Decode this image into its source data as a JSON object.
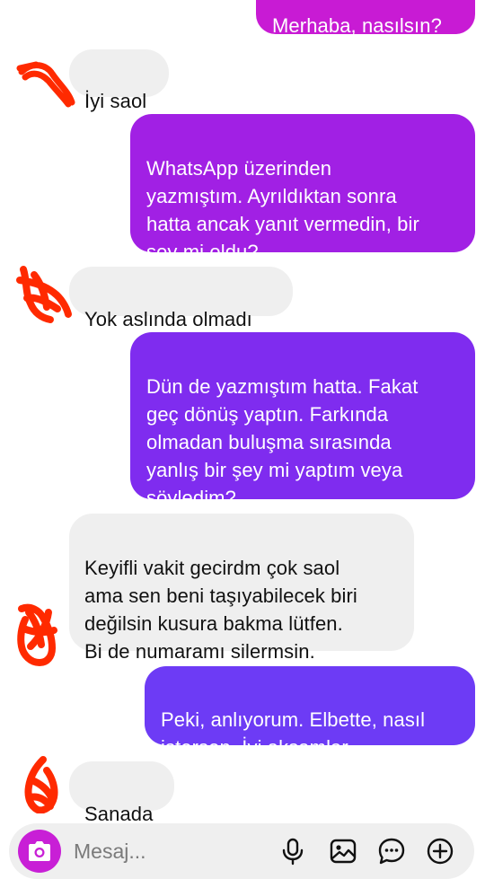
{
  "messages": [
    {
      "side": "out",
      "text": "Merhaba, nasılsın?"
    },
    {
      "side": "in",
      "text": "İyi saol"
    },
    {
      "side": "out",
      "text": "WhatsApp üzerinden\nyazmıştım. Ayrıldıktan sonra\nhatta ancak yanıt vermedin, bir\nşey mi oldu?"
    },
    {
      "side": "in",
      "text": "Yok aslında olmadı"
    },
    {
      "side": "out",
      "text": "Dün de yazmıştım hatta. Fakat\ngeç dönüş yaptın. Farkında\nolmadan buluşma sırasında\nyanlış bir şey mi yaptım veya\nsöyledim?"
    },
    {
      "side": "in",
      "text": "Keyifli vakit gecirdm çok saol\nama sen beni taşıyabilecek biri\ndeğilsin kusura bakma lütfen.\nBi de numaramı silermsin."
    },
    {
      "side": "out",
      "text": "Peki, anlıyorum. Elbette, nasıl\nistersen. İyi akşamlar."
    },
    {
      "side": "in",
      "text": "Sanada"
    }
  ],
  "composer": {
    "placeholder": "Mesaj..."
  },
  "colors": {
    "accent": "#c81fd6",
    "incoming_bg": "#efefef",
    "redaction": "#ff2a00"
  },
  "icons": [
    "camera-icon",
    "microphone-icon",
    "gallery-icon",
    "sticker-icon",
    "add-icon"
  ]
}
